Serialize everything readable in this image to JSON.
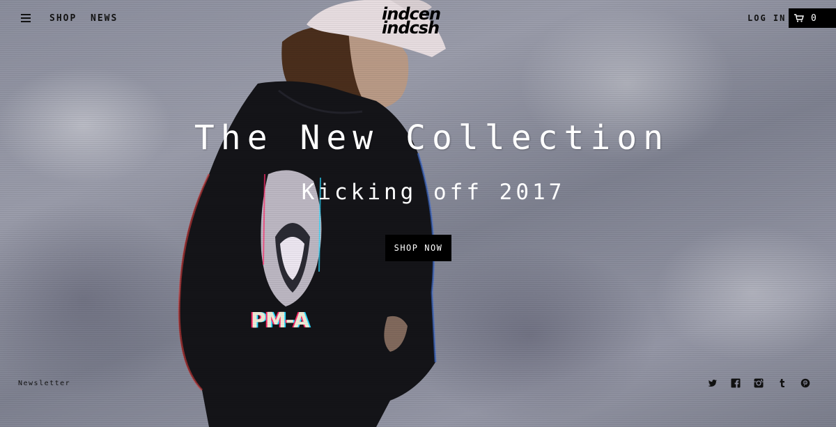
{
  "header": {
    "nav": [
      {
        "label": "SHOP"
      },
      {
        "label": "NEWS"
      }
    ],
    "logo": {
      "line1": "indcen",
      "line2": "indcsh"
    },
    "login_label": "LOG IN",
    "cart_count": "0"
  },
  "hero": {
    "title": "The New Collection",
    "subtitle": "Kicking off 2017",
    "cta_label": "SHOP NOW",
    "hoodie_print": "PM-A"
  },
  "footer": {
    "newsletter_label": "Newsletter",
    "social_icons": [
      "twitter-icon",
      "facebook-icon",
      "instagram-icon",
      "tumblr-icon",
      "pinterest-icon"
    ]
  },
  "colors": {
    "text_dark": "#111111",
    "button_bg": "#000000",
    "button_text": "#ffffff",
    "hero_text": "#ffffff"
  }
}
